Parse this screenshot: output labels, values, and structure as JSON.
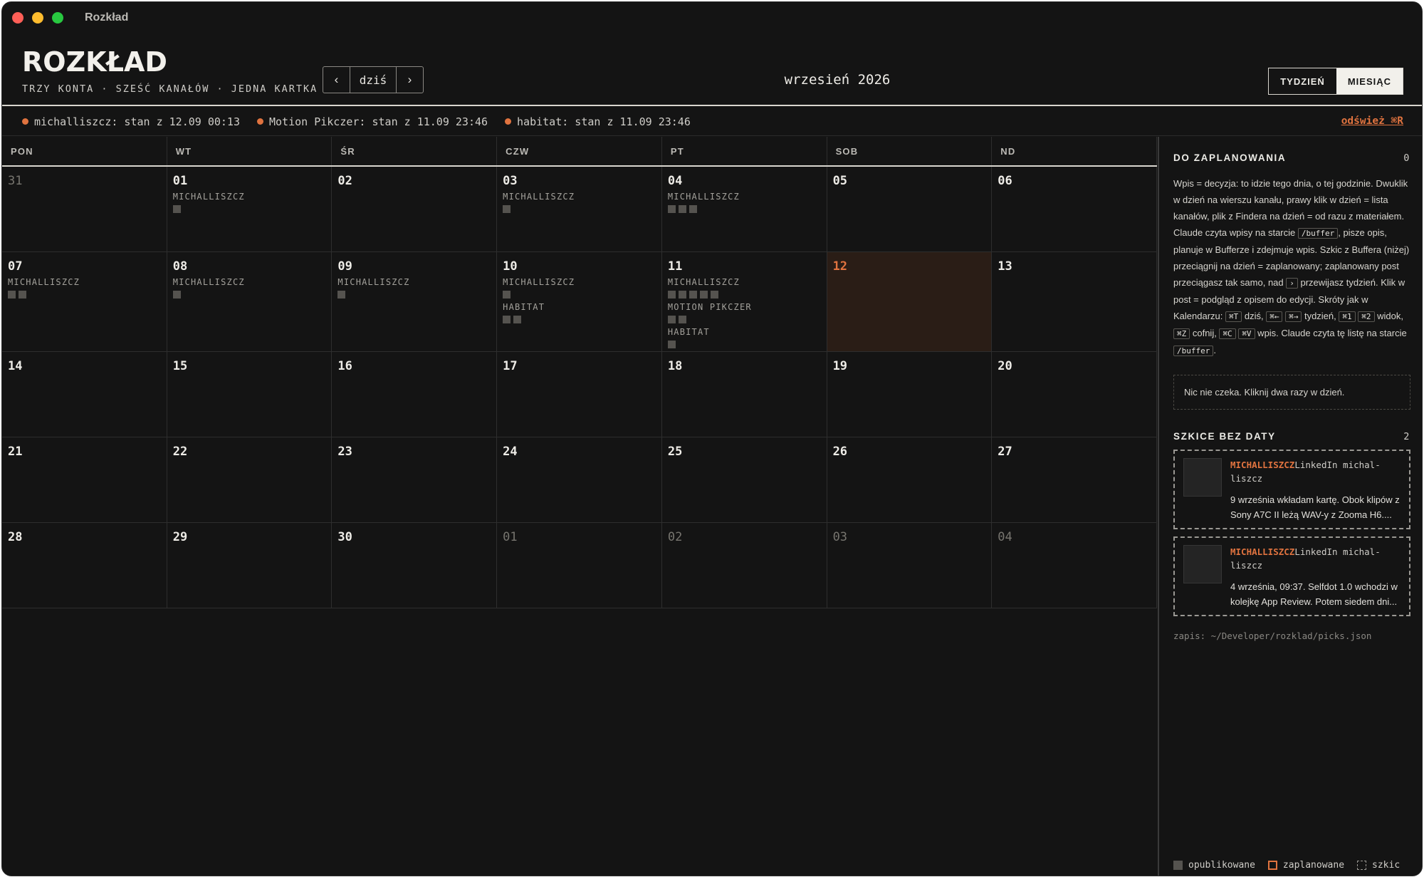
{
  "window": {
    "title": "Rozkład"
  },
  "header": {
    "brand": "ROZKŁAD",
    "tagline": "TRZY KONTA · SZEŚĆ KANAŁÓW · JEDNA KARTKA",
    "prev": "‹",
    "today": "dziś",
    "next": "›",
    "month": "wrzesień 2026",
    "view_week": "TYDZIEŃ",
    "view_month": "MIESIĄC",
    "active_view": "MIESIĄC"
  },
  "status": [
    {
      "text": "michalliszcz: stan z 12.09 00:13"
    },
    {
      "text": "Motion Pikczer: stan z 11.09 23:46"
    },
    {
      "text": "habitat: stan z 11.09 23:46"
    }
  ],
  "refresh": "odśwież ⌘R",
  "calendar": {
    "weekdays": [
      "PON",
      "WT",
      "ŚR",
      "CZW",
      "PT",
      "SOB",
      "ND"
    ],
    "days": [
      {
        "n": "31",
        "dim": true,
        "ch": []
      },
      {
        "n": "01",
        "ch": [
          {
            "name": "MICHALLISZCZ",
            "count": 1
          }
        ]
      },
      {
        "n": "02",
        "ch": []
      },
      {
        "n": "03",
        "ch": [
          {
            "name": "MICHALLISZCZ",
            "count": 1
          }
        ]
      },
      {
        "n": "04",
        "ch": [
          {
            "name": "MICHALLISZCZ",
            "count": 3
          }
        ]
      },
      {
        "n": "05",
        "ch": []
      },
      {
        "n": "06",
        "ch": []
      },
      {
        "n": "07",
        "ch": [
          {
            "name": "MICHALLISZCZ",
            "count": 2
          }
        ]
      },
      {
        "n": "08",
        "ch": [
          {
            "name": "MICHALLISZCZ",
            "count": 1
          }
        ]
      },
      {
        "n": "09",
        "ch": [
          {
            "name": "MICHALLISZCZ",
            "count": 1
          }
        ]
      },
      {
        "n": "10",
        "ch": [
          {
            "name": "MICHALLISZCZ",
            "count": 1
          },
          {
            "name": "HABITAT",
            "count": 2
          }
        ]
      },
      {
        "n": "11",
        "ch": [
          {
            "name": "MICHALLISZCZ",
            "count": 5
          },
          {
            "name": "MOTION PIKCZER",
            "count": 2
          },
          {
            "name": "HABITAT",
            "count": 1
          }
        ]
      },
      {
        "n": "12",
        "today": true,
        "ch": []
      },
      {
        "n": "13",
        "ch": []
      },
      {
        "n": "14",
        "ch": []
      },
      {
        "n": "15",
        "ch": []
      },
      {
        "n": "16",
        "ch": []
      },
      {
        "n": "17",
        "ch": []
      },
      {
        "n": "18",
        "ch": []
      },
      {
        "n": "19",
        "ch": []
      },
      {
        "n": "20",
        "ch": []
      },
      {
        "n": "21",
        "ch": []
      },
      {
        "n": "22",
        "ch": []
      },
      {
        "n": "23",
        "ch": []
      },
      {
        "n": "24",
        "ch": []
      },
      {
        "n": "25",
        "ch": []
      },
      {
        "n": "26",
        "ch": []
      },
      {
        "n": "27",
        "ch": []
      },
      {
        "n": "28",
        "ch": []
      },
      {
        "n": "29",
        "ch": []
      },
      {
        "n": "30",
        "ch": []
      },
      {
        "n": "01",
        "dim": true,
        "ch": []
      },
      {
        "n": "02",
        "dim": true,
        "ch": []
      },
      {
        "n": "03",
        "dim": true,
        "ch": []
      },
      {
        "n": "04",
        "dim": true,
        "ch": []
      }
    ]
  },
  "sidebar": {
    "to_schedule": {
      "title": "DO ZAPLANOWANIA",
      "count": "0",
      "desc_parts": [
        {
          "t": "Wpis = decyzja: to idzie tego dnia, o tej godzinie. Dwuklik w dzień na wierszu kanału, prawy klik w dzień = lista kanałów, plik z Findera na dzień = od razu z materiałem. Claude czyta wpisy na starcie "
        },
        {
          "k": "/buffer"
        },
        {
          "t": ", pisze opis, planuje w Bufferze i zdejmuje wpis. Szkic z Buffera (niżej) przeciągnij na dzień = zaplanowany; zaplanowany post przeciągasz tak samo, nad "
        },
        {
          "k": "›"
        },
        {
          "t": " przewijasz tydzień. Klik w post = podgląd z opisem do edycji. Skróty jak w Kalendarzu: "
        },
        {
          "k": "⌘T"
        },
        {
          "t": " dziś, "
        },
        {
          "k": "⌘←"
        },
        {
          "t": " "
        },
        {
          "k": "⌘→"
        },
        {
          "t": " tydzień, "
        },
        {
          "k": "⌘1"
        },
        {
          "t": " "
        },
        {
          "k": "⌘2"
        },
        {
          "t": " widok, "
        },
        {
          "k": "⌘Z"
        },
        {
          "t": " cofnij, "
        },
        {
          "k": "⌘C"
        },
        {
          "t": " "
        },
        {
          "k": "⌘V"
        },
        {
          "t": " wpis. Claude czyta tę listę na starcie "
        },
        {
          "k": "/buffer"
        },
        {
          "t": "."
        }
      ],
      "empty": "Nic nie czeka. Kliknij dwa razy w dzień."
    },
    "drafts": {
      "title": "SZKICE BEZ DATY",
      "count": "2",
      "items": [
        {
          "account": "MICHALLISZCZ",
          "meta": "LinkedIn michal-liszcz",
          "text": "9 września wkładam kartę. Obok klipów z Sony A7C II leżą WAV-y z Zooma H6...."
        },
        {
          "account": "MICHALLISZCZ",
          "meta": "LinkedIn michal-liszcz",
          "text": "4 września, 09:37. Selfdot 1.0 wchodzi w kolejkę App Review. Potem siedem dni..."
        }
      ]
    },
    "save_path": "zapis: ~/Developer/rozklad/picks.json",
    "legend": {
      "published": "opublikowane",
      "scheduled": "zaplanowane",
      "draft": "szkic"
    }
  },
  "colors": {
    "accent": "#e0733f",
    "bg": "#141414",
    "published": "#55534f"
  }
}
